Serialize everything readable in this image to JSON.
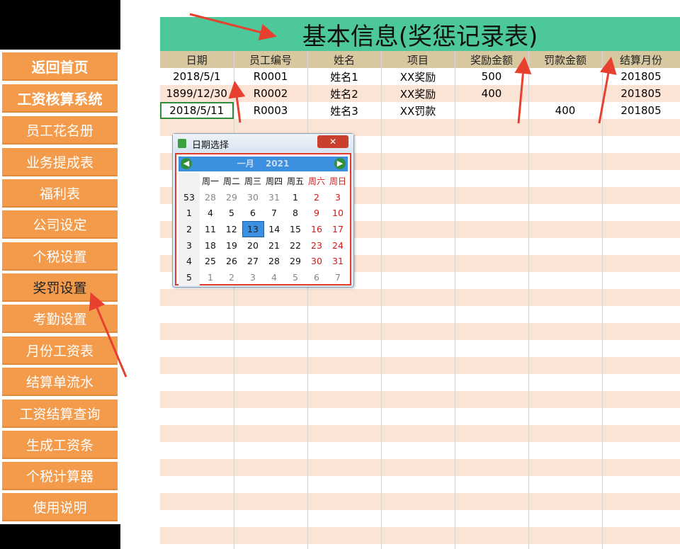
{
  "nav": {
    "items": [
      {
        "label": "返回首页"
      },
      {
        "label": "工资核算系统"
      },
      {
        "label": "员工花名册"
      },
      {
        "label": "业务提成表"
      },
      {
        "label": "福利表"
      },
      {
        "label": "公司设定"
      },
      {
        "label": "个税设置"
      },
      {
        "label": "奖罚设置"
      },
      {
        "label": "考勤设置"
      },
      {
        "label": "月份工资表"
      },
      {
        "label": "结算单流水"
      },
      {
        "label": "工资结算查询"
      },
      {
        "label": "生成工资条"
      },
      {
        "label": "个税计算器"
      },
      {
        "label": "使用说明"
      }
    ],
    "active": "奖罚设置"
  },
  "sheet": {
    "title": "基本信息(奖惩记录表)",
    "columns": [
      "日期",
      "员工编号",
      "姓名",
      "项目",
      "奖励金额",
      "罚款金额",
      "结算月份"
    ],
    "rows": [
      [
        "2018/5/1",
        "R0001",
        "姓名1",
        "XX奖励",
        "500",
        "",
        "201805"
      ],
      [
        "1899/12/30",
        "R0002",
        "姓名2",
        "XX奖励",
        "400",
        "",
        "201805"
      ],
      [
        "2018/5/11",
        "R0003",
        "姓名3",
        "XX罚款",
        "",
        "400",
        "201805"
      ]
    ],
    "selected_cell": "2018/5/11"
  },
  "date_picker": {
    "title": "日期选择",
    "close_label": "✕",
    "month": "一月",
    "year": "2021",
    "prev_icon": "arrow-left-icon",
    "next_icon": "arrow-right-icon",
    "weekdays": [
      "周一",
      "周二",
      "周三",
      "周四",
      "周五",
      "周六",
      "周日"
    ],
    "weeks": [
      {
        "week": "53",
        "days": [
          "28",
          "29",
          "30",
          "31",
          "1",
          "2",
          "3"
        ]
      },
      {
        "week": "1",
        "days": [
          "4",
          "5",
          "6",
          "7",
          "8",
          "9",
          "10"
        ]
      },
      {
        "week": "2",
        "days": [
          "11",
          "12",
          "13",
          "14",
          "15",
          "16",
          "17"
        ]
      },
      {
        "week": "3",
        "days": [
          "18",
          "19",
          "20",
          "21",
          "22",
          "23",
          "24"
        ]
      },
      {
        "week": "4",
        "days": [
          "25",
          "26",
          "27",
          "28",
          "29",
          "30",
          "31"
        ]
      },
      {
        "week": "5",
        "days": [
          "1",
          "2",
          "3",
          "4",
          "5",
          "6",
          "7"
        ]
      }
    ],
    "selected_day": "13",
    "colors": {
      "header": "#3d8fe0",
      "weekend": "#d21a1a",
      "highlight": "#e03b2b"
    }
  },
  "colors": {
    "nav_button": "#f39b4b",
    "title_band": "#4cc89a",
    "column_header": "#d8c8a0",
    "row_alt": "#fbe4d5",
    "arrow": "#e8402f"
  }
}
